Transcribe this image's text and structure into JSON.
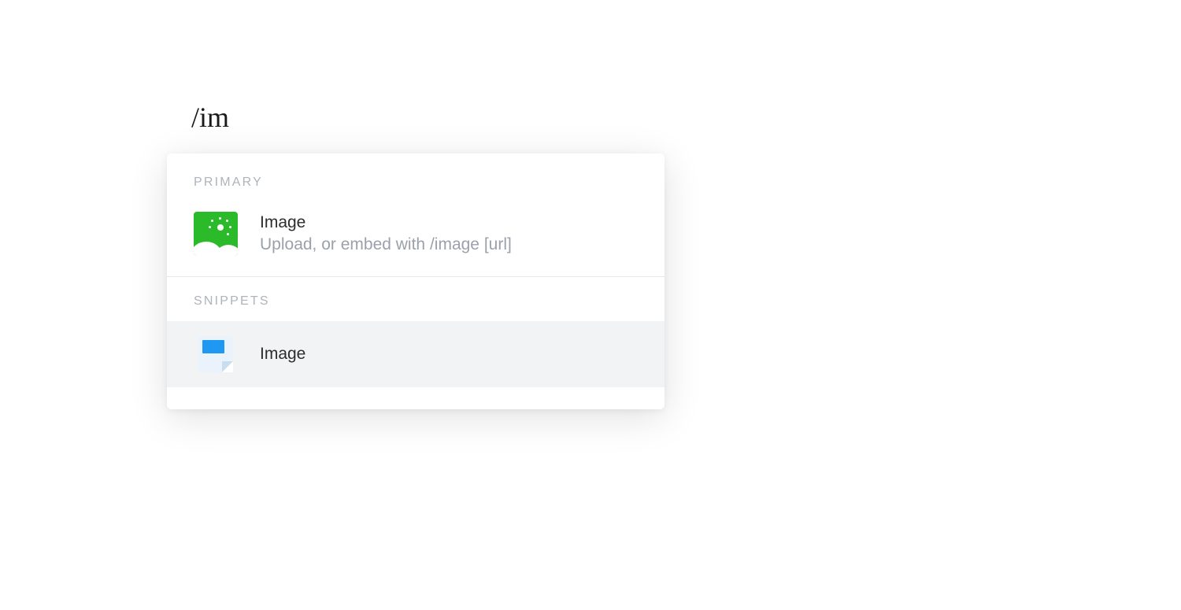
{
  "slash_command": "/im",
  "sections": {
    "primary": {
      "label": "PRIMARY",
      "items": [
        {
          "icon": "image-icon",
          "title": "Image",
          "description": "Upload, or embed with /image [url]",
          "highlighted": false
        }
      ]
    },
    "snippets": {
      "label": "SNIPPETS",
      "items": [
        {
          "icon": "snippet-icon",
          "title": "Image",
          "highlighted": true
        }
      ]
    }
  }
}
